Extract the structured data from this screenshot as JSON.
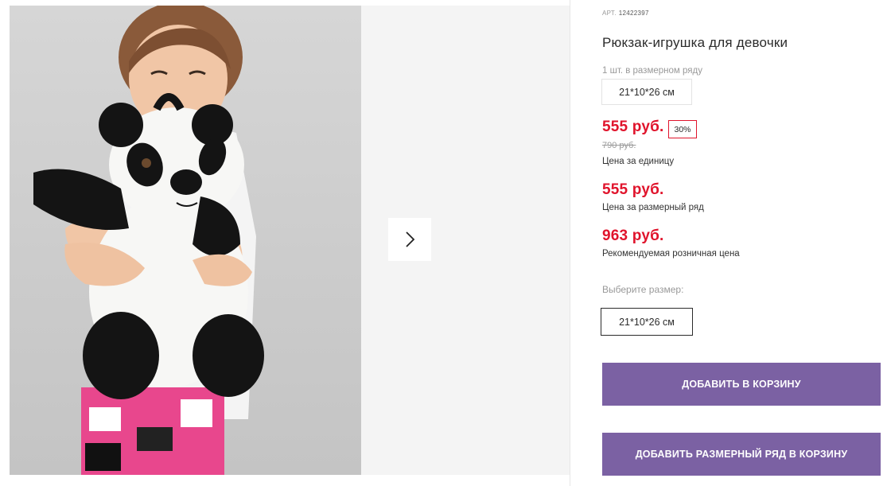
{
  "gallery": {
    "next_icon": "chevron-right-icon"
  },
  "product": {
    "sku_label": "АРТ.",
    "sku_value": "12422397",
    "title": "Рюкзак-игрушка для девочки",
    "pack_label": "1 шт. в размерном ряду",
    "pack_size": "21*10*26 см",
    "unit_price": "555 руб.",
    "discount": "30%",
    "old_price": "790 руб.",
    "unit_price_caption": "Цена за единицу",
    "row_price": "555 руб.",
    "row_price_caption": "Цена за размерный ряд",
    "retail_price": "963 руб.",
    "retail_price_caption": "Рекомендуемая розничная цена",
    "choose_size_label": "Выберите размер:",
    "size_options": [
      "21*10*26 см"
    ]
  },
  "actions": {
    "add_to_cart": "ДОБАВИТЬ В КОРЗИНУ",
    "add_row_to_cart": "ДОБАВИТЬ РАЗМЕРНЫЙ РЯД В КОРЗИНУ"
  },
  "colors": {
    "price_red": "#e0142c",
    "button_purple": "#7b61a3"
  }
}
